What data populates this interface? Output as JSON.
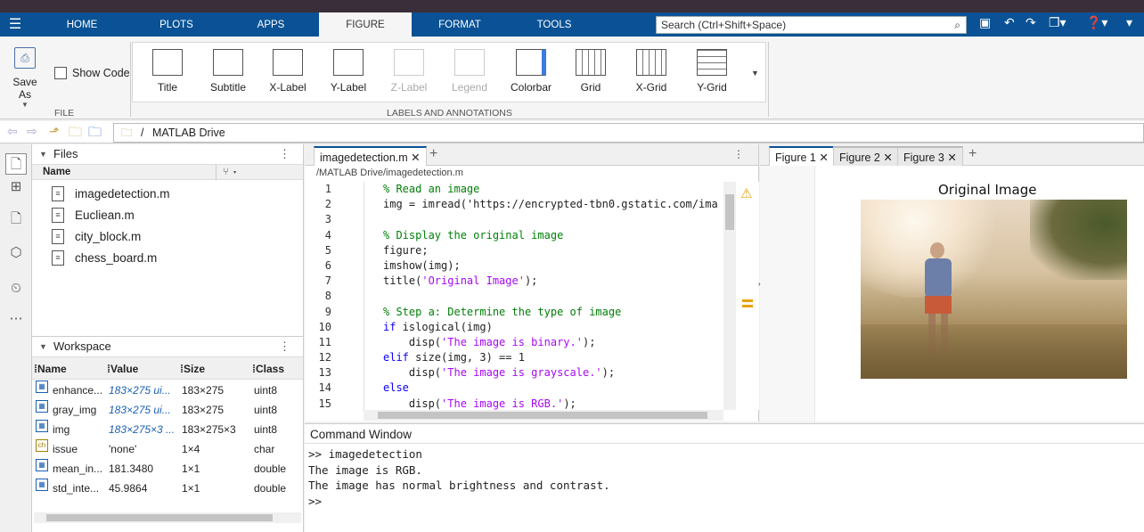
{
  "ribbon_tabs": [
    "HOME",
    "PLOTS",
    "APPS",
    "FIGURE",
    "FORMAT",
    "TOOLS"
  ],
  "search": {
    "placeholder": "Search (Ctrl+Shift+Space)"
  },
  "file_group": {
    "save_as": "Save As",
    "show_code": "Show Code",
    "label": "FILE"
  },
  "labels_group": {
    "label": "LABELS AND ANNOTATIONS",
    "buttons": [
      "Title",
      "Subtitle",
      "X-Label",
      "Y-Label",
      "Z-Label",
      "Legend",
      "Colorbar",
      "Grid",
      "X-Grid",
      "Y-Grid"
    ]
  },
  "address": {
    "sep": "/",
    "folder": "MATLAB Drive"
  },
  "files_panel": {
    "title": "Files",
    "col_name": "Name",
    "items": [
      "imagedetection.m",
      "Eucliean.m",
      "city_block.m",
      "chess_board.m"
    ]
  },
  "workspace": {
    "title": "Workspace",
    "cols": [
      "Name",
      "Value",
      "Size",
      "Class"
    ],
    "rows": [
      {
        "icon": "matrix",
        "name": "enhance...",
        "value": "183×275 ui...",
        "size": "183×275",
        "class": "uint8"
      },
      {
        "icon": "matrix",
        "name": "gray_img",
        "value": "183×275 ui...",
        "size": "183×275",
        "class": "uint8"
      },
      {
        "icon": "matrix",
        "name": "img",
        "value": "183×275×3 ...",
        "size": "183×275×3",
        "class": "uint8"
      },
      {
        "icon": "char",
        "name": "issue",
        "value": "'none'",
        "size": "1×4",
        "class": "char"
      },
      {
        "icon": "matrix",
        "name": "mean_in...",
        "value": "181.3480",
        "size": "1×1",
        "class": "double"
      },
      {
        "icon": "matrix",
        "name": "std_inte...",
        "value": "45.9864",
        "size": "1×1",
        "class": "double"
      }
    ]
  },
  "editor": {
    "tab": "imagedetection.m",
    "path": "/MATLAB Drive/imagedetection.m",
    "lines": [
      {
        "n": "1",
        "t": "% Read an image"
      },
      {
        "n": "2",
        "t": "img = imread('https://encrypted-tbn0.gstatic.com/ima"
      },
      {
        "n": "3",
        "t": ""
      },
      {
        "n": "4",
        "t": "% Display the original image"
      },
      {
        "n": "5",
        "t": "figure;"
      },
      {
        "n": "6",
        "t": "imshow(img);"
      },
      {
        "n": "7",
        "t": "title('Original Image');"
      },
      {
        "n": "8",
        "t": ""
      },
      {
        "n": "9",
        "t": "% Step a: Determine the type of image"
      },
      {
        "n": "10",
        "t": "if islogical(img)"
      },
      {
        "n": "11",
        "t": "    disp('The image is binary.');"
      },
      {
        "n": "12",
        "t": "elif size(img, 3) == 1"
      },
      {
        "n": "13",
        "t": "    disp('The image is grayscale.');"
      },
      {
        "n": "14",
        "t": "else"
      },
      {
        "n": "15",
        "t": "    disp('The image is RGB.');"
      }
    ]
  },
  "figures": {
    "tabs": [
      "Figure 1",
      "Figure 2",
      "Figure 3"
    ],
    "plot_title": "Original Image"
  },
  "command_window": {
    "title": "Command Window",
    "lines": [
      ">> imagedetection",
      "The image is RGB.",
      "The image has normal brightness and contrast.",
      ">>"
    ]
  },
  "colors": {
    "brand_blue": "#0a5295",
    "comment": "#028009",
    "string": "#a709f5",
    "keyword": "#0e00ff"
  }
}
